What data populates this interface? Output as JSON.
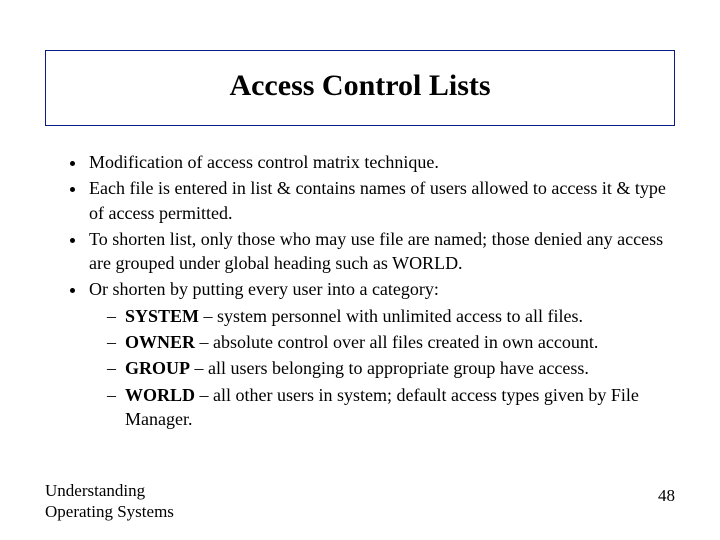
{
  "title": "Access Control Lists",
  "bullets": {
    "b1": "Modification of access control matrix technique.",
    "b2": "Each file is entered in list & contains names of users allowed to access it & type of access permitted.",
    "b3": "To shorten list, only those who may use file are named; those denied any access are grouped under global heading such as WORLD.",
    "b4": "Or shorten by putting every user into a category:",
    "cat1_name": "SYSTEM",
    "cat1_desc": " – system personnel with unlimited access to all files.",
    "cat2_name": "OWNER",
    "cat2_desc": " – absolute control over all files created in own account.",
    "cat3_name": "GROUP",
    "cat3_desc": " – all users belonging to appropriate group have access.",
    "cat4_name": "WORLD",
    "cat4_desc": " – all other users in system; default access types given by File Manager."
  },
  "footer": {
    "left_line1": "Understanding",
    "left_line2": "Operating Systems",
    "page": "48"
  }
}
